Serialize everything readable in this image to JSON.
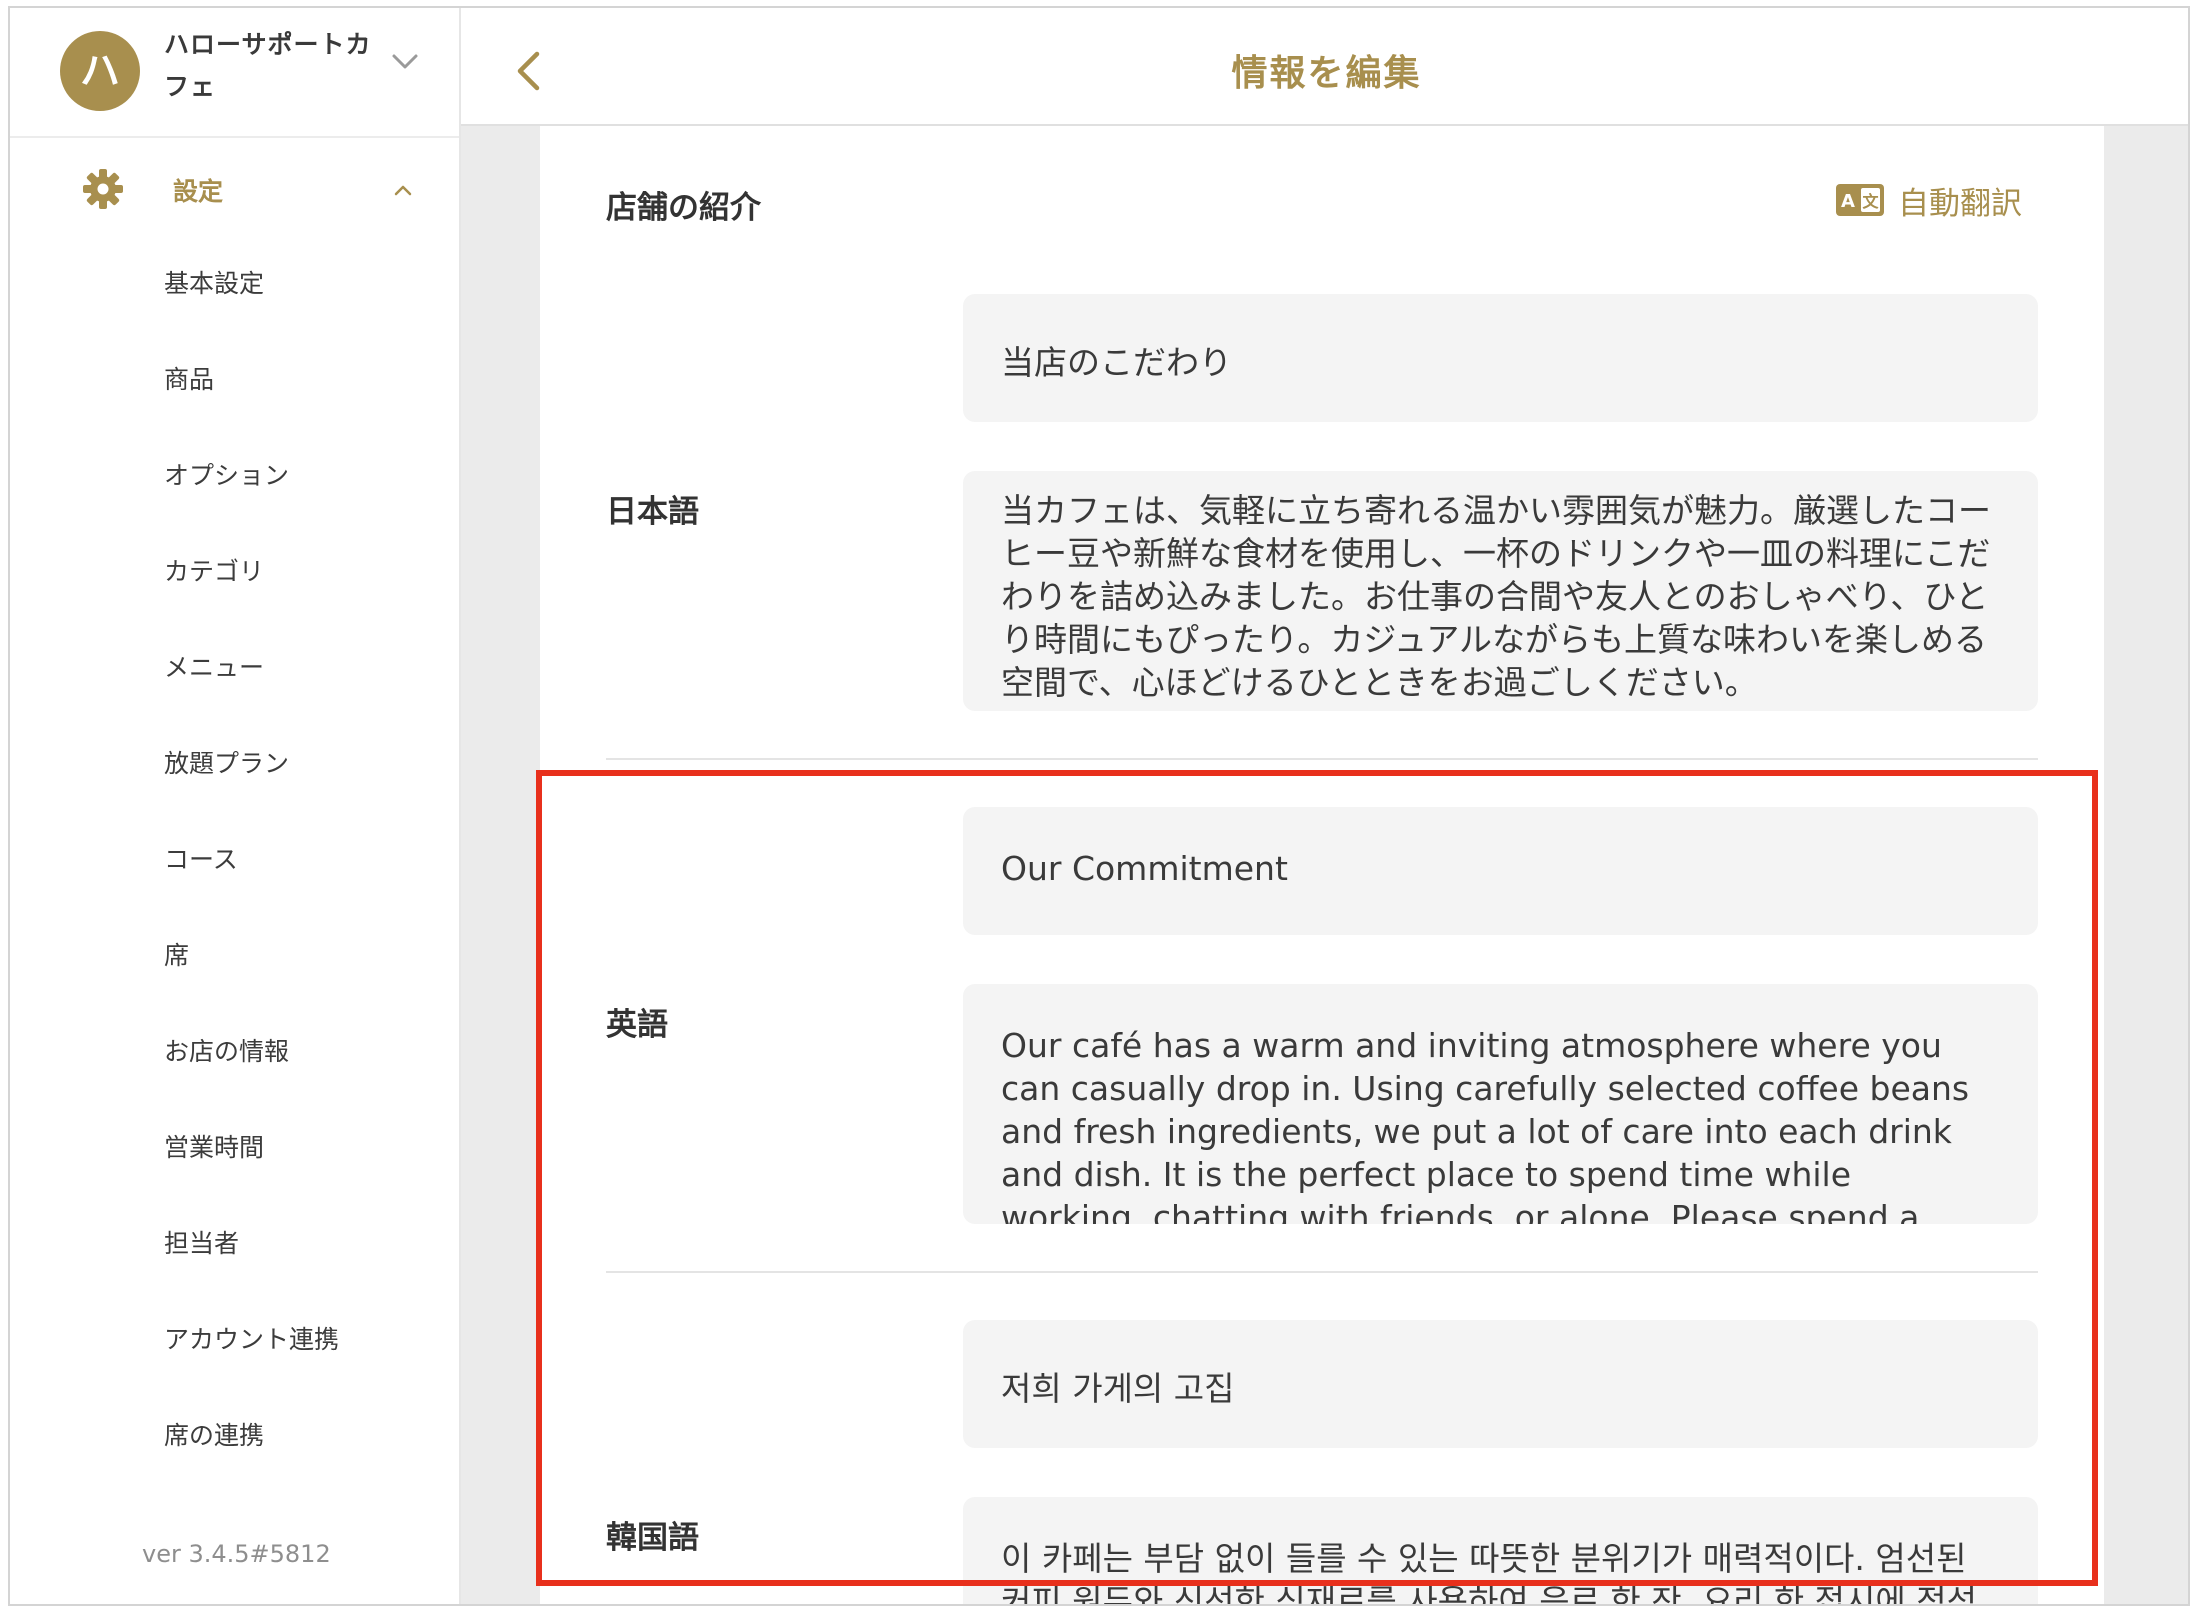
{
  "store": {
    "initial": "ハ",
    "name": "ハローサポートカフェ"
  },
  "sidebar": {
    "section_label": "設定",
    "items": [
      {
        "label": "基本設定"
      },
      {
        "label": "商品"
      },
      {
        "label": "オプション"
      },
      {
        "label": "カテゴリ"
      },
      {
        "label": "メニュー"
      },
      {
        "label": "放題プラン"
      },
      {
        "label": "コース"
      },
      {
        "label": "席"
      },
      {
        "label": "お店の情報"
      },
      {
        "label": "営業時間"
      },
      {
        "label": "担当者"
      },
      {
        "label": "アカウント連携"
      },
      {
        "label": "席の連携"
      }
    ],
    "version": "ver 3.4.5#5812"
  },
  "header": {
    "title": "情報を編集"
  },
  "main": {
    "section_title": "店舗の紹介",
    "auto_translate_label": "自動翻訳",
    "languages": [
      {
        "label": "日本語",
        "title_value": "当店のこだわり",
        "body_value": "当カフェは、気軽に立ち寄れる温かい雰囲気が魅力。厳選したコーヒー豆や新鮮な食材を使用し、一杯のドリンクや一皿の料理にこだわりを詰め込みました。お仕事の合間や友人とのおしゃべり、ひとり時間にもぴったり。カジュアルながらも上質な味わいを楽しめる空間で、心ほどけるひとときをお過ごしください。"
      },
      {
        "label": "英語",
        "title_value": "Our Commitment",
        "body_value": "Our café has a warm and inviting atmosphere where you can casually drop in. Using carefully selected coffee beans and fresh ingredients, we put a lot of care into each drink and dish. It is the perfect place to spend time while working, chatting with friends, or alone. Please spend a relaxing moment in a"
      },
      {
        "label": "韓国語",
        "title_value": "저희 가게의 고집",
        "body_value": "이 카페는 부담 없이 들를 수 있는 따뜻한 분위기가 매력적이다. 엄선된 커피 원두와 신선한 식재료를 사용하여 음료 한 잔, 요리 한 접시에 정성"
      }
    ]
  },
  "colors": {
    "accent": "#a88f4e",
    "highlight": "#e8301c",
    "field_bg": "#f4f4f4"
  }
}
